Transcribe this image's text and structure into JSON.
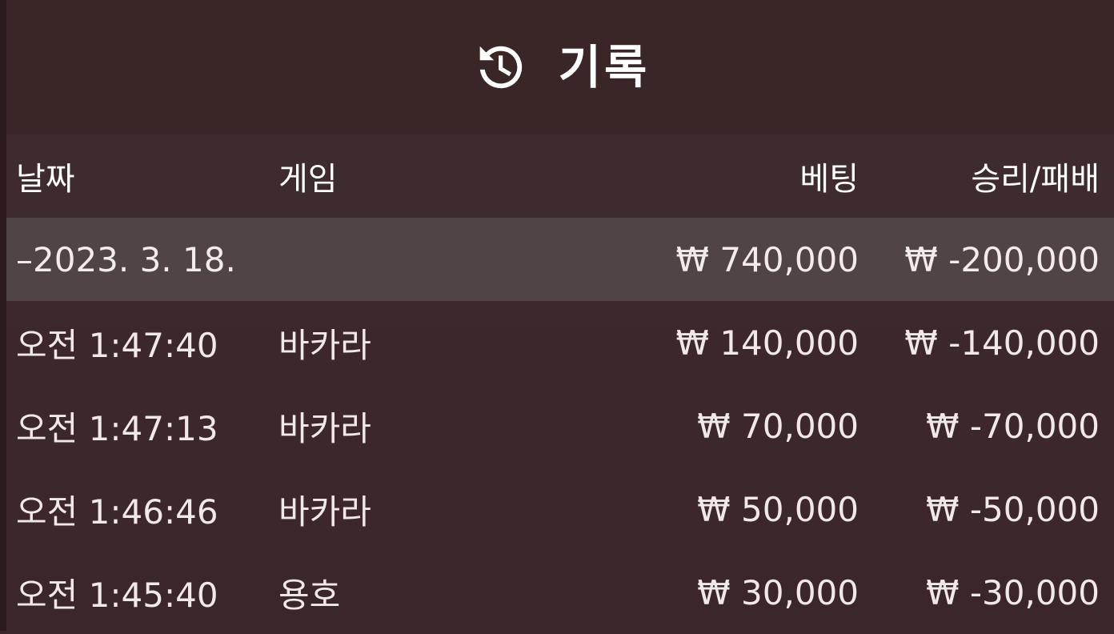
{
  "header": {
    "title": "기록"
  },
  "table": {
    "columns": {
      "date": "날짜",
      "game": "게임",
      "bet": "베팅",
      "result": "승리/패배"
    },
    "group": {
      "date": "–2023. 3. 18.",
      "bet": "₩ 740,000",
      "result": "₩ -200,000"
    },
    "rows": [
      {
        "time": "오전 1:47:40",
        "game": "바카라",
        "bet": "₩ 140,000",
        "result": "₩ -140,000"
      },
      {
        "time": "오전 1:47:13",
        "game": "바카라",
        "bet": "₩ 70,000",
        "result": "₩ -70,000"
      },
      {
        "time": "오전 1:46:46",
        "game": "바카라",
        "bet": "₩ 50,000",
        "result": "₩ -50,000"
      },
      {
        "time": "오전 1:45:40",
        "game": "용호",
        "bet": "₩ 30,000",
        "result": "₩ -30,000"
      }
    ]
  },
  "icons": {
    "history": "history-icon"
  },
  "colors": {
    "background": "#3b2628",
    "group_row": "#514445",
    "text": "#f2ecec"
  }
}
